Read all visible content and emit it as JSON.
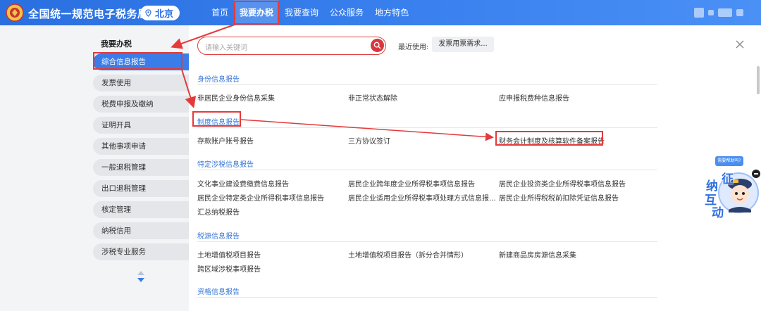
{
  "header": {
    "site_title": "全国统一规范电子税务局",
    "region": "北京",
    "nav": [
      "首页",
      "我要办税",
      "我要查询",
      "公众服务",
      "地方特色"
    ]
  },
  "sidebar": {
    "title": "我要办税",
    "items": [
      "综合信息报告",
      "发票使用",
      "税费申报及缴纳",
      "证明开具",
      "其他事项申请",
      "一般退税管理",
      "出口退税管理",
      "核定管理",
      "纳税信用",
      "涉税专业服务"
    ]
  },
  "main": {
    "search_placeholder": "请输入关键词",
    "recent_label": "最近使用:",
    "recent_chip": "发票用票需求...",
    "sections": [
      {
        "title": "身份信息报告",
        "items": [
          "非居民企业身份信息采集",
          "非正常状态解除",
          "应申报税费种信息报告"
        ]
      },
      {
        "title": "制度信息报告",
        "items": [
          "存款账户账号报告",
          "三方协议签订",
          "财务会计制度及核算软件备案报告"
        ]
      },
      {
        "title": "特定涉税信息报告",
        "items": [
          "文化事业建设费缴费信息报告",
          "居民企业跨年度企业所得税事项信息报告",
          "居民企业投资类企业所得税事项信息报告",
          "居民企业特定类企业所得税事项信息报告",
          "居民企业适用企业所得税事项处理方式信息报...",
          "居民企业所得税税前扣除凭证信息报告",
          "汇总纳税报告"
        ]
      },
      {
        "title": "税源信息报告",
        "items": [
          "土地增值税项目报告",
          "土地增值税项目报告（拆分合并情形）",
          "新建商品房房源信息采集",
          "跨区域涉税事项报告"
        ]
      },
      {
        "title": "资格信息报告",
        "items": []
      }
    ]
  },
  "helper": {
    "bubble": "需要帮助吗?",
    "chars": [
      "征",
      "纳",
      "互",
      "动"
    ]
  },
  "colors": {
    "header_blue": "#2a6fe0",
    "section_blue": "#3a78d8",
    "highlight_red": "#e43a3a",
    "search_red": "#d9363e"
  }
}
